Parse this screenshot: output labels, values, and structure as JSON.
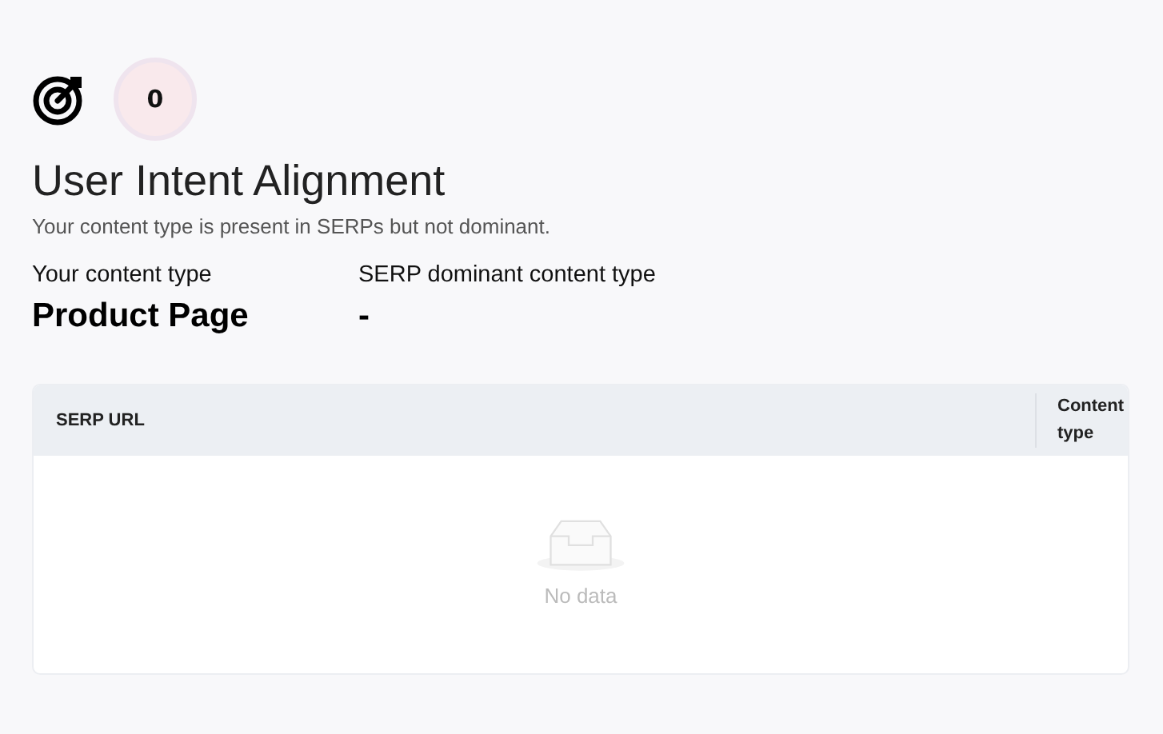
{
  "score": {
    "value": "0"
  },
  "title": "User Intent Alignment",
  "subtitle": "Your content type is present in SERPs but not dominant.",
  "content_types": [
    {
      "label": "Your content type",
      "value": "Product Page"
    },
    {
      "label": "SERP dominant content type",
      "value": "-"
    }
  ],
  "table": {
    "columns": [
      "SERP URL",
      "Content type"
    ],
    "empty_text": "No data"
  }
}
